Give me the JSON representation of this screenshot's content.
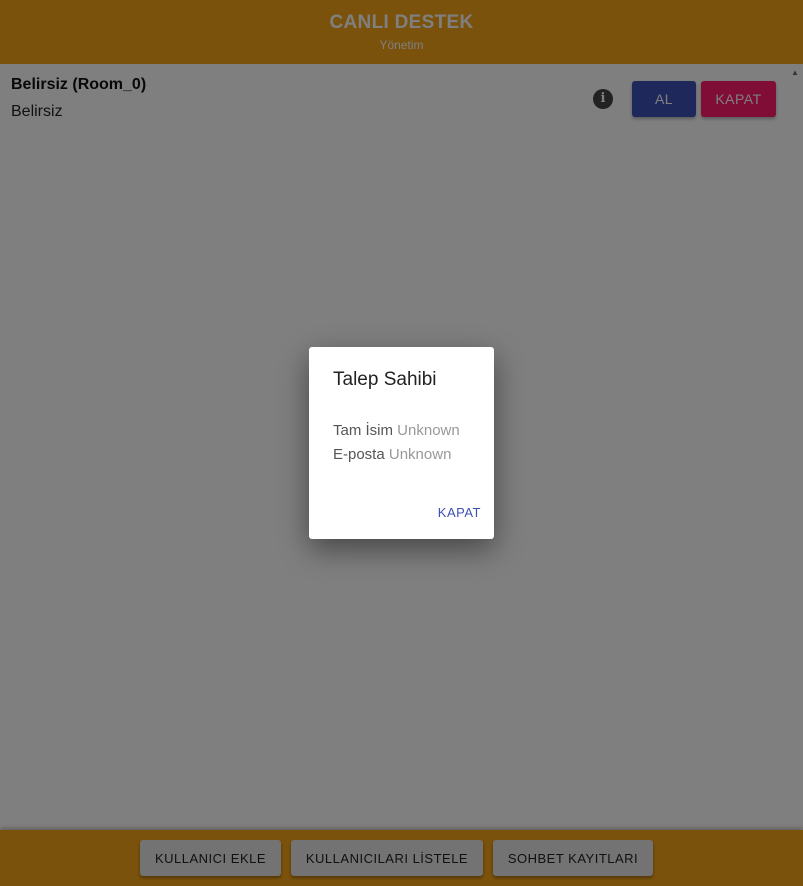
{
  "header": {
    "title": "CANLI DESTEK",
    "subtitle": "Yönetim"
  },
  "room": {
    "name": "Belirsiz (Room_0)",
    "status": "Belirsiz",
    "info_icon": "info-icon",
    "accept_label": "AL",
    "close_label": "KAPAT"
  },
  "footer": {
    "add_user_label": "KULLANICI EKLE",
    "list_users_label": "KULLANICILARI LİSTELE",
    "chat_logs_label": "SOHBET KAYITLARI"
  },
  "dialog": {
    "title": "Talep Sahibi",
    "fullname_label": "Tam İsim",
    "fullname_value": "Unknown",
    "email_label": "E-posta",
    "email_value": "Unknown",
    "close_label": "KAPAT"
  },
  "colors": {
    "header_bg": "#f5a417",
    "primary": "#3f51b5",
    "accent": "#ff1a6b",
    "overlay": "rgba(0,0,0,0.5)"
  }
}
